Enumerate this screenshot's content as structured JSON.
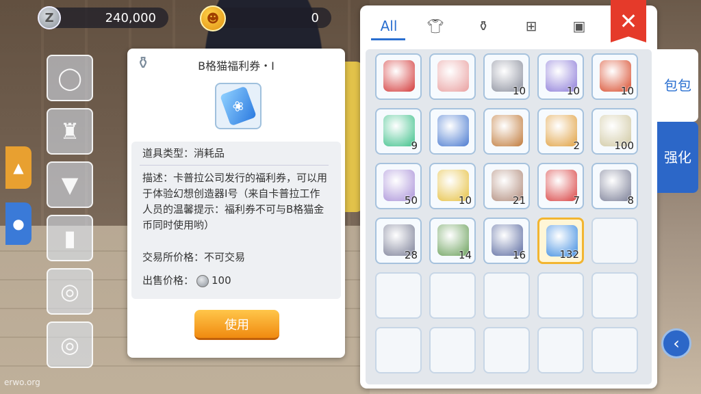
{
  "currency": {
    "zeny": "240,000",
    "cat_coin": "0",
    "zeny_symbol": "Z",
    "cat_symbol": "☻"
  },
  "tooltip": {
    "title": "B格猫福利券・I",
    "type_label": "道具类型：消耗品",
    "desc": "描述：卡普拉公司发行的福利券，可以用于体验幻想创造器Ⅰ号（来自卡普拉工作人员的温馨提示：福利券不可与B格猫金币同时使用哟）",
    "trade_label": "交易所价格：不可交易",
    "sell_label": "出售价格：",
    "sell_value": "100",
    "use_button": "使用"
  },
  "tabs": [
    "All",
    "shirt-icon",
    "pouch-icon",
    "grid-icon",
    "card-icon"
  ],
  "close_icon": "✕",
  "side_tabs": {
    "bag": "包包",
    "enhance": "强化"
  },
  "watermark": "erwo.org",
  "items": [
    {
      "icon": "red-dress",
      "color": "#d33a3a",
      "count": ""
    },
    {
      "icon": "forbidden-branch",
      "color": "#e9a0a0",
      "count": ""
    },
    {
      "icon": "gray-box",
      "color": "#8a8e9c",
      "count": "10"
    },
    {
      "icon": "scroll",
      "color": "#8b7ad8",
      "count": "10"
    },
    {
      "icon": "red-pouch",
      "color": "#d84a2a",
      "count": "10"
    },
    {
      "icon": "green-orb",
      "color": "#3dc08a",
      "count": "9"
    },
    {
      "icon": "blue-staff",
      "color": "#4a7ad0",
      "count": ""
    },
    {
      "icon": "treasure-chest",
      "color": "#c07a3a",
      "count": ""
    },
    {
      "icon": "winged-badge",
      "color": "#e0a040",
      "count": "2"
    },
    {
      "icon": "cheese",
      "color": "#cfc7a0",
      "count": "100"
    },
    {
      "icon": "purple-crystal",
      "color": "#a890d8",
      "count": "50"
    },
    {
      "icon": "gold-gem",
      "color": "#e6c040",
      "count": "10"
    },
    {
      "icon": "cat-coin-badge",
      "color": "#b08a7a",
      "count": "21"
    },
    {
      "icon": "gift-box",
      "color": "#d84040",
      "count": "7"
    },
    {
      "icon": "gray-ore",
      "color": "#7a7e96",
      "count": "8"
    },
    {
      "icon": "gray-ore-2",
      "color": "#7a7e96",
      "count": "28"
    },
    {
      "icon": "herb-leaves",
      "color": "#6aa05a",
      "count": "14"
    },
    {
      "icon": "chain",
      "color": "#5a6aa0",
      "count": "16"
    },
    {
      "icon": "blue-ticket",
      "color": "#3a8ae0",
      "count": "132",
      "selected": true
    }
  ],
  "accent_colors": {
    "blue": "#2a6fd0",
    "close_red": "#e53a2a",
    "use_orange": "#f08a10"
  }
}
